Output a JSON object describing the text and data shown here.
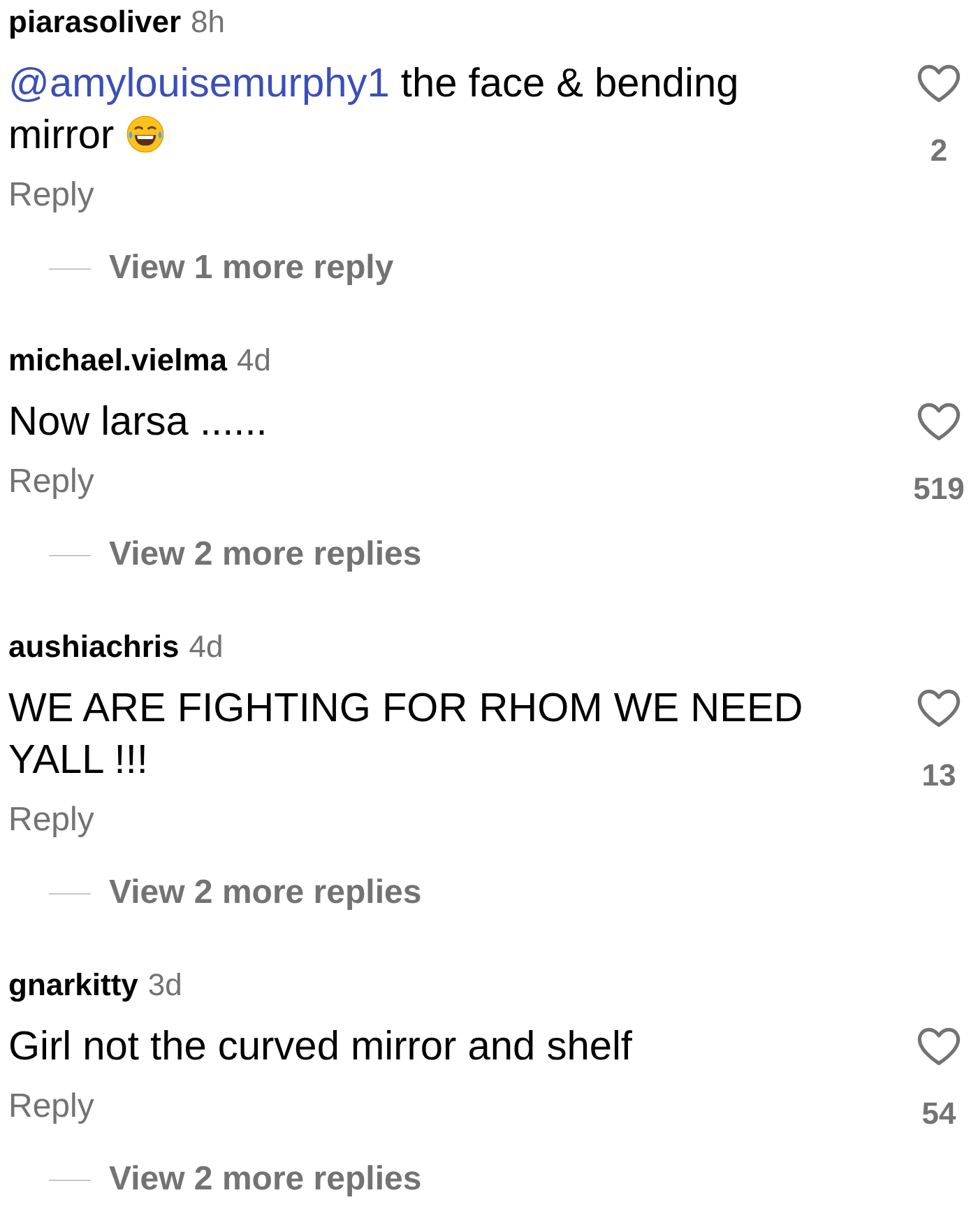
{
  "comments": [
    {
      "username": "piarasoliver",
      "time": "8h",
      "mention": "@amylouisemurphy1",
      "text": " the face & bending mirror",
      "emoji": true,
      "reply": "Reply",
      "likes": "2",
      "liked": false,
      "view_replies": "View 1 more reply"
    },
    {
      "username": "michael.vielma",
      "time": "4d",
      "text": "Now larsa ......",
      "emoji": false,
      "reply": "Reply",
      "likes": "519",
      "liked": false,
      "view_replies": "View 2 more replies"
    },
    {
      "username": "aushiachris",
      "time": "4d",
      "text": "WE ARE FIGHTING FOR RHOM WE NEED YALL !!!",
      "emoji": false,
      "reply": "Reply",
      "likes": "13",
      "liked": false,
      "view_replies": "View 2 more replies"
    },
    {
      "username": "gnarkitty",
      "time": "3d",
      "text": "Girl not the curved mirror and shelf",
      "emoji": false,
      "reply": "Reply",
      "likes": "54",
      "liked": false,
      "view_replies": "View 2 more replies"
    }
  ]
}
